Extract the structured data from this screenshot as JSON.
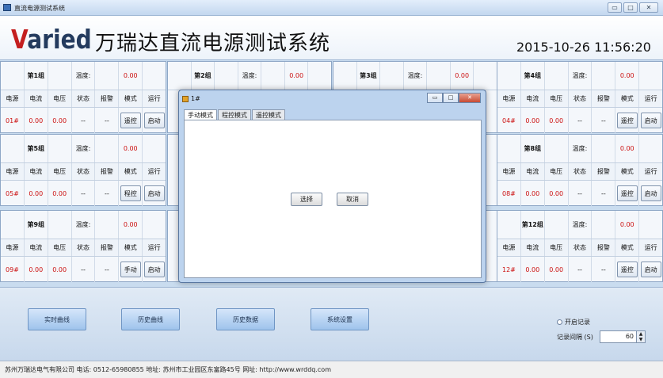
{
  "window": {
    "title": "直流电源测试系统",
    "minimize": "▭",
    "maximize": "□",
    "close": "✕"
  },
  "header": {
    "logo": "Varied",
    "title": "万瑞达直流电源测试系统",
    "datetime": "2015-10-26 11:56:20"
  },
  "columns": [
    "电源",
    "电流",
    "电压",
    "状态",
    "报警",
    "模式",
    "运行"
  ],
  "temp_label": "温度:",
  "groups": [
    {
      "name": "第1组",
      "temp": "0.00",
      "id": "01#",
      "current": "0.00",
      "voltage": "0.00",
      "status": "--",
      "alarm": "--",
      "mode": "遥控",
      "run": "启动"
    },
    {
      "name": "第2组",
      "temp": "0.00"
    },
    {
      "name": "第3组",
      "temp": "0.00"
    },
    {
      "name": "第4组",
      "temp": "0.00",
      "id": "04#",
      "current": "0.00",
      "voltage": "0.00",
      "status": "--",
      "alarm": "--",
      "mode": "遥控",
      "run": "启动"
    },
    {
      "name": "第5组",
      "temp": "0.00",
      "id": "05#",
      "current": "0.00",
      "voltage": "0.00",
      "status": "--",
      "alarm": "--",
      "mode": "程控",
      "run": "启动"
    },
    {
      "name": "第8组",
      "temp": "0.00",
      "id": "08#",
      "current": "0.00",
      "voltage": "0.00",
      "status": "--",
      "alarm": "--",
      "mode": "遥控",
      "run": "启动"
    },
    {
      "name": "第9组",
      "temp": "0.00",
      "id": "09#",
      "current": "0.00",
      "voltage": "0.00",
      "status": "--",
      "alarm": "--",
      "mode": "手动",
      "run": "启动"
    },
    {
      "name": "第12组",
      "temp": "0.00",
      "id": "12#",
      "current": "0.00",
      "voltage": "0.00",
      "status": "--",
      "alarm": "--",
      "mode": "遥控",
      "run": "启动"
    }
  ],
  "dialog": {
    "title": "1#",
    "tabs": [
      "手动模式",
      "程控模式",
      "遥控模式"
    ],
    "select": "选择",
    "cancel": "取消"
  },
  "bottom": {
    "buttons": [
      "实时曲线",
      "历史曲线",
      "历史数据",
      "系统设置"
    ],
    "record_toggle": "开启记录",
    "interval_label": "记录间隔 (S)",
    "interval_value": "60"
  },
  "footer": "苏州万瑞达电气有限公司  电话: 0512-65980855  地址: 苏州市工业园区东富路45号  网址: http://www.wrddq.com",
  "colors": {
    "accent": "#c41f1f",
    "button": "#9ec3ec",
    "background": "#c9dcef"
  }
}
